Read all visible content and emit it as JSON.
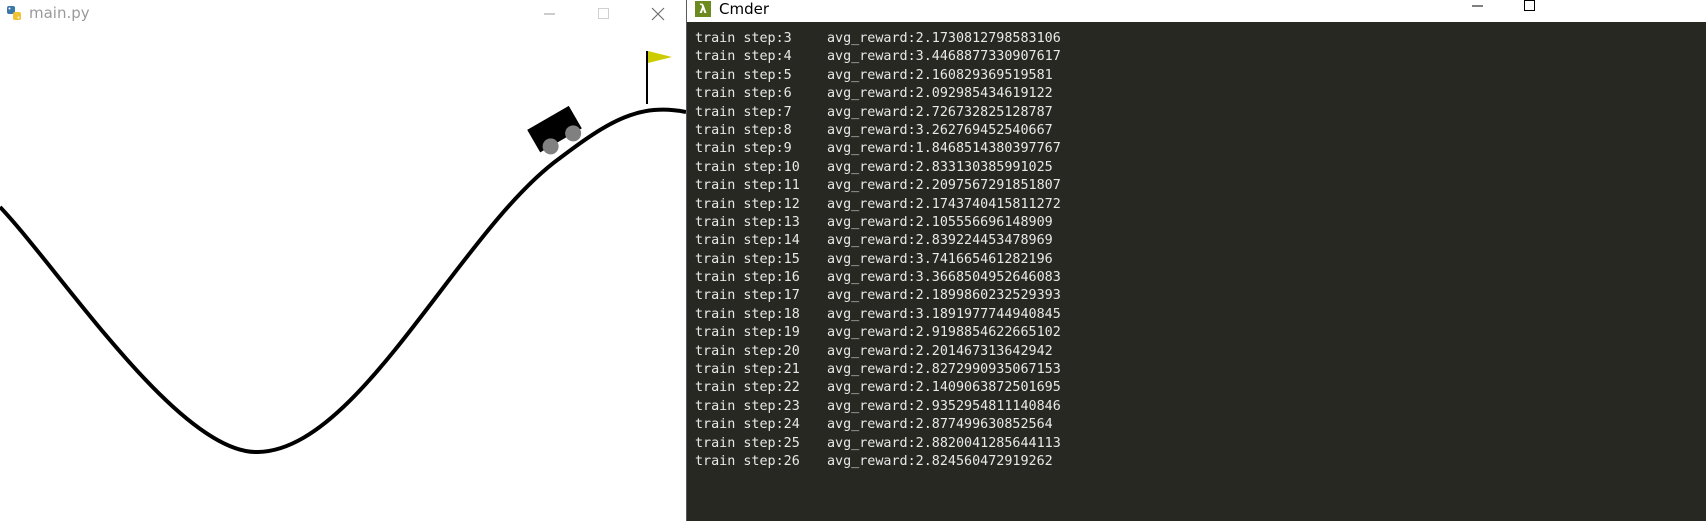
{
  "left_window": {
    "title": "main.py",
    "icon": "python-icon",
    "controls": [
      "minimize-icon",
      "maximize-icon",
      "close-icon"
    ],
    "scene": {
      "description_icon": "mountain-car-environment",
      "flag_color": "#cccc00",
      "track_color": "#000000",
      "car_color": "#000000",
      "wheel_color": "#808080"
    }
  },
  "right_window": {
    "title": "Cmder",
    "icon": "lambda-icon",
    "controls": [
      "minimize-icon",
      "maximize-icon"
    ],
    "log": [
      {
        "step": "train step:3",
        "reward": "avg_reward:2.1730812798583106"
      },
      {
        "step": "train step:4",
        "reward": "avg_reward:3.4468877330907617"
      },
      {
        "step": "train step:5",
        "reward": "avg_reward:2.160829369519581"
      },
      {
        "step": "train step:6",
        "reward": "avg_reward:2.092985434619122"
      },
      {
        "step": "train step:7",
        "reward": "avg_reward:2.726732825128787"
      },
      {
        "step": "train step:8",
        "reward": "avg_reward:3.262769452540667"
      },
      {
        "step": "train step:9",
        "reward": "avg_reward:1.8468514380397767"
      },
      {
        "step": "train step:10",
        "reward": "avg_reward:2.833130385991025"
      },
      {
        "step": "train step:11",
        "reward": "avg_reward:2.2097567291851807"
      },
      {
        "step": "train step:12",
        "reward": "avg_reward:2.1743740415811272"
      },
      {
        "step": "train step:13",
        "reward": "avg_reward:2.105556696148909"
      },
      {
        "step": "train step:14",
        "reward": "avg_reward:2.839224453478969"
      },
      {
        "step": "train step:15",
        "reward": "avg_reward:3.741665461282196"
      },
      {
        "step": "train step:16",
        "reward": "avg_reward:3.3668504952646083"
      },
      {
        "step": "train step:17",
        "reward": "avg_reward:2.1899860232529393"
      },
      {
        "step": "train step:18",
        "reward": "avg_reward:3.1891977744940845"
      },
      {
        "step": "train step:19",
        "reward": "avg_reward:2.9198854622665102"
      },
      {
        "step": "train step:20",
        "reward": "avg_reward:2.201467313642942"
      },
      {
        "step": "train step:21",
        "reward": "avg_reward:2.8272990935067153"
      },
      {
        "step": "train step:22",
        "reward": "avg_reward:2.1409063872501695"
      },
      {
        "step": "train step:23",
        "reward": "avg_reward:2.9352954811140846"
      },
      {
        "step": "train step:24",
        "reward": "avg_reward:2.877499630852564"
      },
      {
        "step": "train step:25",
        "reward": "avg_reward:2.8820041285644113"
      },
      {
        "step": "train step:26",
        "reward": "avg_reward:2.824560472919262"
      }
    ]
  }
}
